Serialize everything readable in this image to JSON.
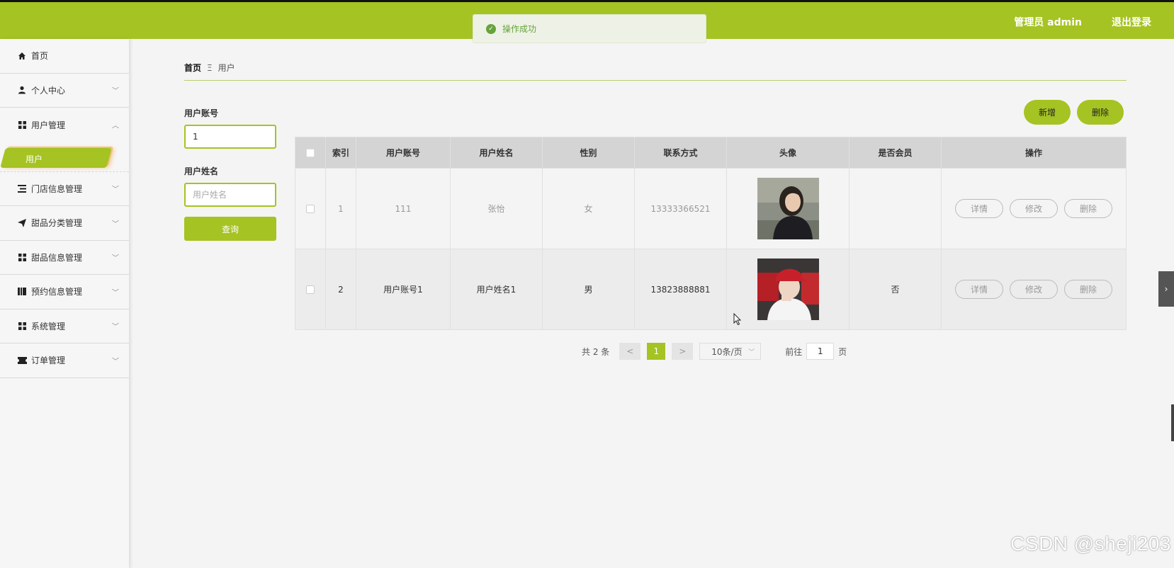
{
  "header": {
    "user": "管理员 admin",
    "logout": "退出登录",
    "accent": "#a5c322"
  },
  "toast": {
    "message": "操作成功"
  },
  "sidebar": {
    "items": [
      {
        "label": "首页",
        "icon": "home-icon"
      },
      {
        "label": "个人中心",
        "icon": "person-icon"
      },
      {
        "label": "用户管理",
        "icon": "grid-icon",
        "expanded": true
      },
      {
        "label": "门店信息管理",
        "icon": "list-icon"
      },
      {
        "label": "甜品分类管理",
        "icon": "send-icon"
      },
      {
        "label": "甜品信息管理",
        "icon": "grid-icon"
      },
      {
        "label": "预约信息管理",
        "icon": "book-icon"
      },
      {
        "label": "系统管理",
        "icon": "grid-icon"
      },
      {
        "label": "订单管理",
        "icon": "ticket-icon"
      }
    ],
    "sub_item": "用户"
  },
  "breadcrumb": {
    "home": "首页",
    "separator": "Ξ",
    "current": "用户"
  },
  "search": {
    "account_label": "用户账号",
    "account_value": "1",
    "name_label": "用户姓名",
    "name_placeholder": "用户姓名",
    "query_button": "查询"
  },
  "actions": {
    "add": "新增",
    "delete": "删除"
  },
  "table": {
    "headers": [
      "索引",
      "用户账号",
      "用户姓名",
      "性别",
      "联系方式",
      "头像",
      "是否会员",
      "操作"
    ],
    "rows": [
      {
        "index": "1",
        "account": "111",
        "name": "张怡",
        "gender": "女",
        "phone": "13333366521",
        "member": ""
      },
      {
        "index": "2",
        "account": "用户账号1",
        "name": "用户姓名1",
        "gender": "男",
        "phone": "13823888881",
        "member": "否"
      }
    ],
    "ops": {
      "detail": "详情",
      "edit": "修改",
      "delete": "删除"
    }
  },
  "pager": {
    "total": "共 2 条",
    "prev": "<",
    "page": "1",
    "next": ">",
    "size": "10条/页",
    "goto_label": "前往",
    "goto_value": "1",
    "page_suffix": "页"
  },
  "watermark": "CSDN @sheji203"
}
